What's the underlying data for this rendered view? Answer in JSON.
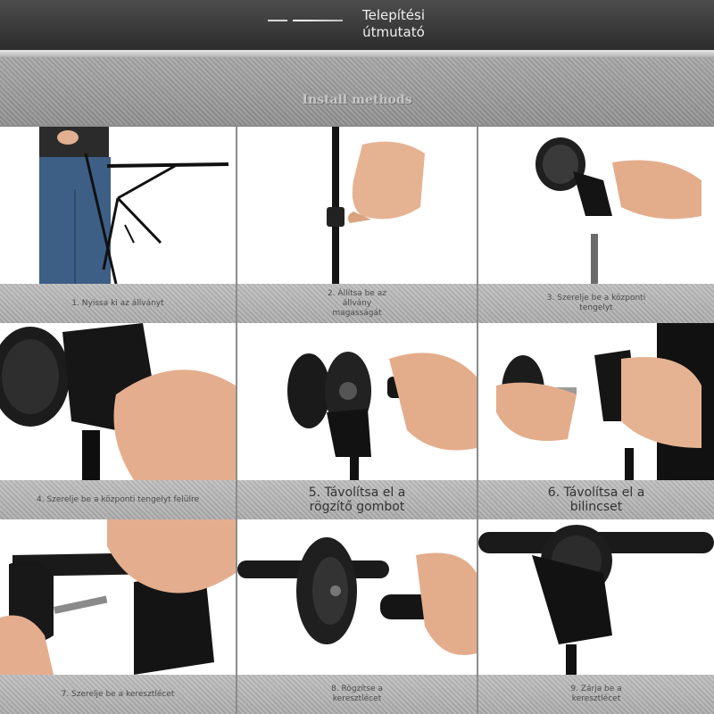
{
  "header": {
    "title": "Telepítési útmutató",
    "subtitle": "Install methods"
  },
  "steps": [
    {
      "caption": "1. Nyissa ki az állványt"
    },
    {
      "caption": "2. Állítsa be az állvány magasságát"
    },
    {
      "caption": "3. Szerelje be a központi tengelyt"
    },
    {
      "caption": "4. Szerelje be a központi tengelyt felülre"
    },
    {
      "caption": "5. Távolítsa el a rögzítő gombot"
    },
    {
      "caption": "6. Távolítsa el a bilincset"
    },
    {
      "caption": "7. Szerelje be a keresztlécet"
    },
    {
      "caption": "8. Rögzítse a keresztlécet"
    },
    {
      "caption": "9. Zárja be a keresztlécet"
    }
  ],
  "colors": {
    "header_bg": "#333333",
    "caption_bg": "#b3b3b3",
    "background": "#8c8c8c"
  }
}
